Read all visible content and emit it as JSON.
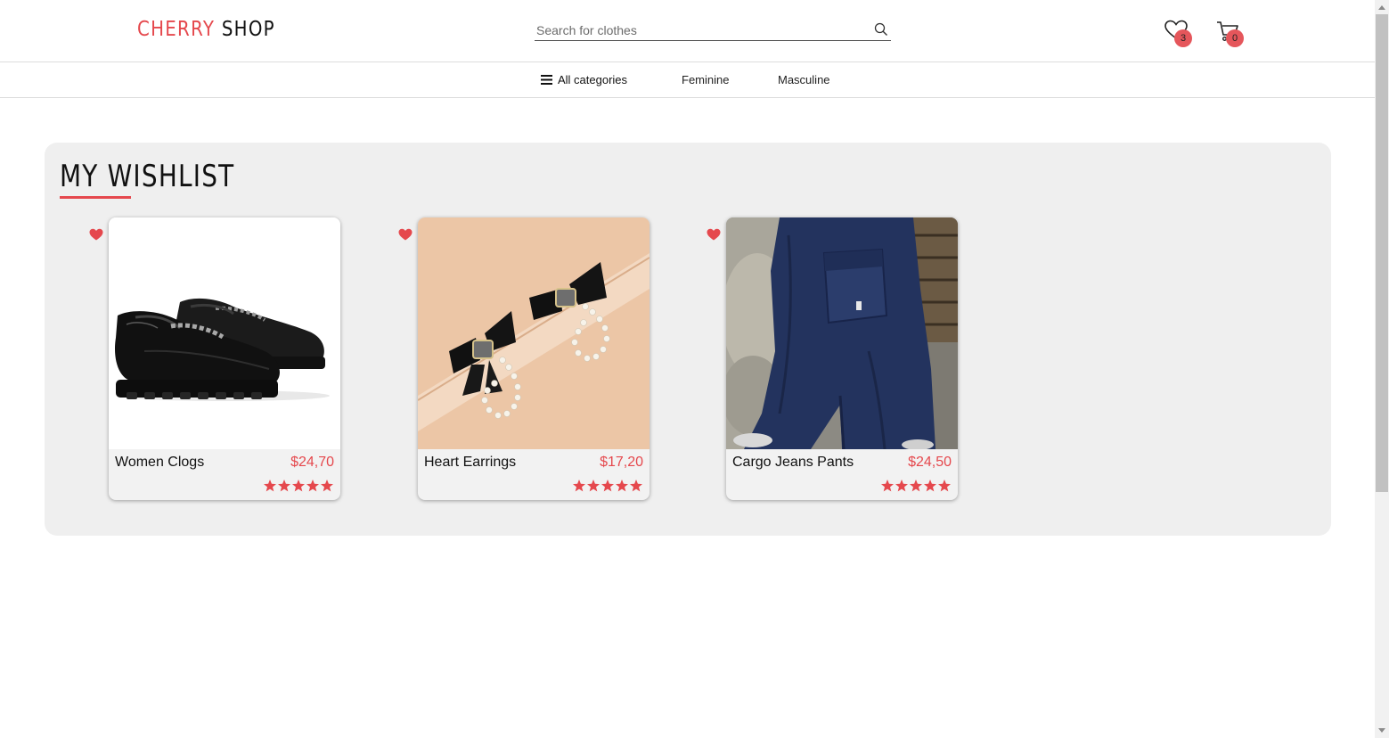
{
  "brand": {
    "part1": "CHERRY",
    "part2": "SHOP",
    "accent_color": "#e5484d"
  },
  "search": {
    "placeholder": "Search for clothes",
    "icon": "search-icon"
  },
  "header_icons": {
    "wishlist": {
      "icon": "heart-outline-icon",
      "count": "3"
    },
    "cart": {
      "icon": "cart-icon",
      "count": "0"
    }
  },
  "nav": {
    "all_categories": "All categories",
    "feminine": "Feminine",
    "masculine": "Masculine"
  },
  "wishlist": {
    "title": "MY WISHLIST",
    "items": [
      {
        "name": "Women Clogs",
        "price": "$24,70",
        "rating": 5,
        "image": "black loafers with chain"
      },
      {
        "name": "Heart Earrings",
        "price": "$17,20",
        "rating": 5,
        "image": "black bow pearl heart earrings"
      },
      {
        "name": "Cargo Jeans Pants",
        "price": "$24,50",
        "rating": 5,
        "image": "dark blue cargo jeans"
      }
    ]
  }
}
